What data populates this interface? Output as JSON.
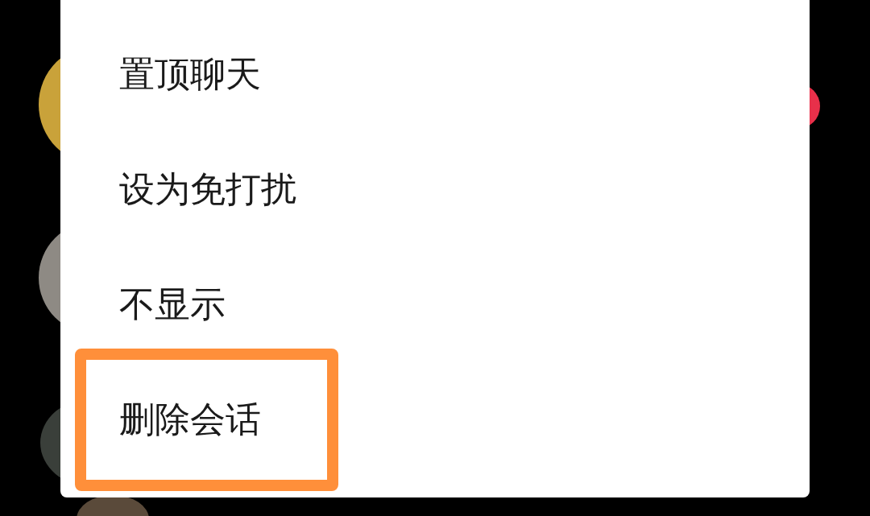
{
  "menu_items": [
    {
      "label": "置顶聊天",
      "highlighted": false
    },
    {
      "label": "设为免打扰",
      "highlighted": false
    },
    {
      "label": "不显示",
      "highlighted": false
    },
    {
      "label": "删除会话",
      "highlighted": true
    }
  ]
}
